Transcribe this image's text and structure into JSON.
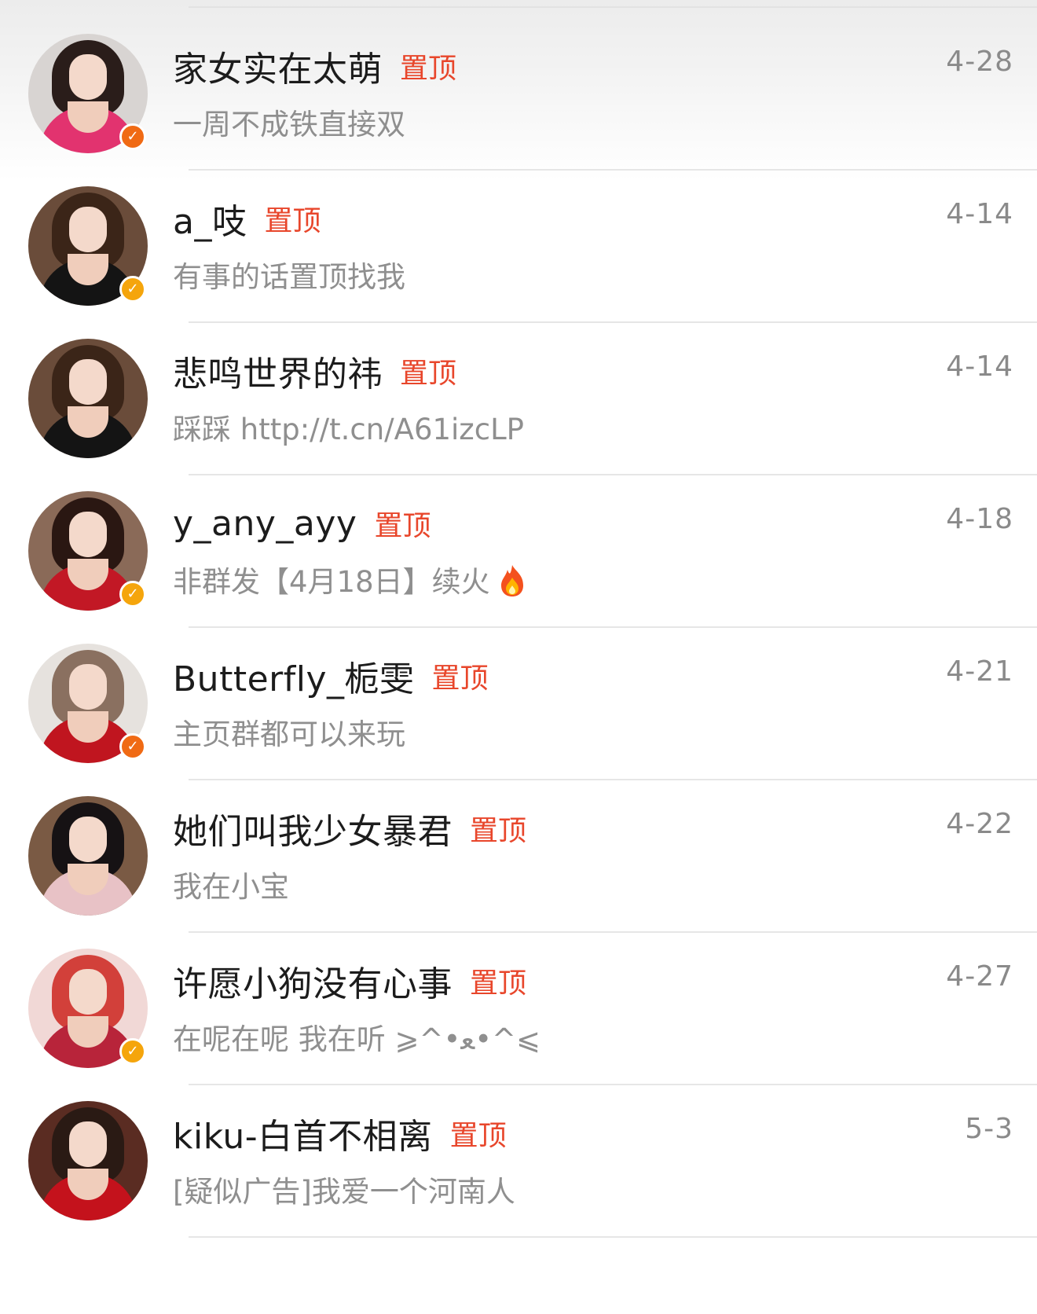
{
  "pin_label": "置顶",
  "conversations": [
    {
      "name": "家女实在太萌",
      "message": "一周不成铁直接双",
      "date": "4-28",
      "verified": "orange",
      "avatar_theme": {
        "hair": "#2a1d1a",
        "body": "#e2336f",
        "bg": "#d8d4d2"
      }
    },
    {
      "name": "a_吱",
      "message": "有事的话置顶找我",
      "date": "4-14",
      "verified": "gold",
      "avatar_theme": {
        "hair": "#3b2518",
        "body": "#141414",
        "bg": "#6a4c3a"
      }
    },
    {
      "name": "悲鸣世界的祎",
      "message": "踩踩 http://t.cn/A61izcLP",
      "date": "4-14",
      "verified": "none",
      "avatar_theme": {
        "hair": "#3b2518",
        "body": "#141414",
        "bg": "#6a4c3a"
      }
    },
    {
      "name": "y_any_ayy",
      "message": "非群发【4月18日】续火",
      "has_fire": true,
      "date": "4-18",
      "verified": "gold",
      "avatar_theme": {
        "hair": "#2a1712",
        "body": "#c21825",
        "bg": "#8a6a58"
      }
    },
    {
      "name": "Butterfly_栀雯",
      "message": "主页群都可以来玩",
      "date": "4-21",
      "verified": "orange",
      "avatar_theme": {
        "hair": "#8a7060",
        "body": "#c0151f",
        "bg": "#e6e2de"
      }
    },
    {
      "name": "她们叫我少女暴君",
      "message": "我在小宝",
      "date": "4-22",
      "verified": "none",
      "avatar_theme": {
        "hair": "#161214",
        "body": "#e8c2c6",
        "bg": "#7a5a44"
      }
    },
    {
      "name": "许愿小狗没有心事",
      "message": "在呢在呢 我在听 ⩾^•ﻌ•^⩽",
      "date": "4-27",
      "verified": "gold",
      "avatar_theme": {
        "hair": "#d2403a",
        "body": "#b8243a",
        "bg": "#f1d8d6"
      }
    },
    {
      "name": "kiku-白首不相离",
      "message": "[疑似广告]我爱一个河南人",
      "date": "5-3",
      "verified": "none",
      "avatar_theme": {
        "hair": "#2a1a14",
        "body": "#c4121c",
        "bg": "#5a2c22"
      }
    }
  ],
  "colors": {
    "orange_badge": "#f06a14",
    "gold_badge": "#f5a50c",
    "pin": "#e8462b"
  }
}
